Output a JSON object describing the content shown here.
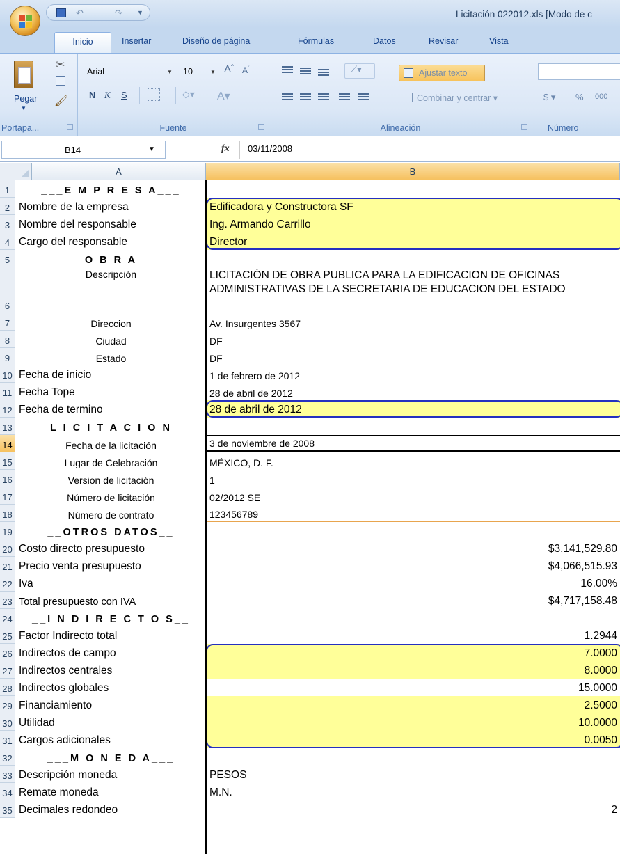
{
  "window": {
    "title": "Licitación 022012.xls  [Modo de c",
    "ghost_undo": "",
    "ghost_title": ""
  },
  "ribbon": {
    "tabs": [
      "Inicio",
      "Insertar",
      "Diseño de página",
      "Fórmulas",
      "Datos",
      "Revisar",
      "Vista"
    ],
    "clipboard": {
      "paste_label": "Pegar",
      "group_label": "Portapa..."
    },
    "font": {
      "name": "Arial",
      "size": "10",
      "bold": "N",
      "italic": "K",
      "underline": "S",
      "group_label": "Fuente"
    },
    "alignment": {
      "wrap_label": "Ajustar texto",
      "merge_label": "Combinar y centrar",
      "group_label": "Alineación"
    },
    "number": {
      "currency": "$",
      "percent": "%",
      "thousands": "000",
      "group_label": "Número"
    }
  },
  "formula_bar": {
    "cell_ref": "B14",
    "fx": "fx",
    "value": "03/11/2008"
  },
  "columns": [
    "A",
    "B"
  ],
  "rows": [
    {
      "n": "1",
      "a": "___E M P R E S A___",
      "b": ""
    },
    {
      "n": "2",
      "a": "Nombre de la empresa",
      "b": "Edificadora y Constructora SF"
    },
    {
      "n": "3",
      "a": "Nombre del responsable",
      "b": "Ing. Armando Carrillo"
    },
    {
      "n": "4",
      "a": "Cargo del responsable",
      "b": "Director"
    },
    {
      "n": "5",
      "a": "___O B R A___",
      "b": ""
    },
    {
      "n": "6",
      "a": "Descripción",
      "b": "LICITACIÓN DE OBRA PUBLICA PARA LA EDIFICACION DE OFICINAS ADMINISTRATIVAS DE LA SECRETARIA DE EDUCACION DEL ESTADO"
    },
    {
      "n": "7",
      "a": "Direccion",
      "b": "Av. Insurgentes 3567"
    },
    {
      "n": "8",
      "a": "Ciudad",
      "b": "DF"
    },
    {
      "n": "9",
      "a": "Estado",
      "b": "DF"
    },
    {
      "n": "10",
      "a": "Fecha de inicio",
      "b": "1 de febrero de 2012"
    },
    {
      "n": "11",
      "a": "Fecha Tope",
      "b": "28 de abril de 2012"
    },
    {
      "n": "12",
      "a": "Fecha de termino",
      "b": "28 de abril de 2012"
    },
    {
      "n": "13",
      "a": "___L I C I T A C I O N___",
      "b": ""
    },
    {
      "n": "14",
      "a": "Fecha de la licitación",
      "b": "3 de noviembre de 2008"
    },
    {
      "n": "15",
      "a": "Lugar de Celebración",
      "b": "MÉXICO, D. F."
    },
    {
      "n": "16",
      "a": "Version de licitación",
      "b": "1"
    },
    {
      "n": "17",
      "a": "Número de licitación",
      "b": "02/2012 SE"
    },
    {
      "n": "18",
      "a": "Número de contrato",
      "b": "123456789"
    },
    {
      "n": "19",
      "a": "__OTROS DATOS__",
      "b": ""
    },
    {
      "n": "20",
      "a": "Costo directo presupuesto",
      "b": "$3,141,529.80"
    },
    {
      "n": "21",
      "a": "Precio venta presupuesto",
      "b": "$4,066,515.93"
    },
    {
      "n": "22",
      "a": "Iva",
      "b": "16.00%"
    },
    {
      "n": "23",
      "a": "Total presupuesto con IVA",
      "b": "$4,717,158.48"
    },
    {
      "n": "24",
      "a": "__I N D I R E C T O S__",
      "b": ""
    },
    {
      "n": "25",
      "a": "Factor Indirecto total",
      "b": "1.2944"
    },
    {
      "n": "26",
      "a": "Indirectos de campo",
      "b": "7.0000"
    },
    {
      "n": "27",
      "a": "Indirectos centrales",
      "b": "8.0000"
    },
    {
      "n": "28",
      "a": "Indirectos globales",
      "b": "15.0000"
    },
    {
      "n": "29",
      "a": "Financiamiento",
      "b": "2.5000"
    },
    {
      "n": "30",
      "a": "Utilidad",
      "b": "10.0000"
    },
    {
      "n": "31",
      "a": "Cargos adicionales",
      "b": "0.0050"
    },
    {
      "n": "32",
      "a": "___M O N E D A___",
      "b": ""
    },
    {
      "n": "33",
      "a": "Descripción moneda",
      "b": "PESOS"
    },
    {
      "n": "34",
      "a": "Remate moneda",
      "b": "M.N."
    },
    {
      "n": "35",
      "a": "Decimales redondeo",
      "b": "2"
    }
  ],
  "colors": {
    "highlight": "#ffff99",
    "annotation_box": "#2530c0",
    "selection_header": "#f6c15f"
  },
  "icons": [
    "office-button-icon",
    "save-icon",
    "undo-icon",
    "redo-icon",
    "paste-icon",
    "cut-icon",
    "copy-icon",
    "format-painter-icon",
    "fx-icon"
  ]
}
